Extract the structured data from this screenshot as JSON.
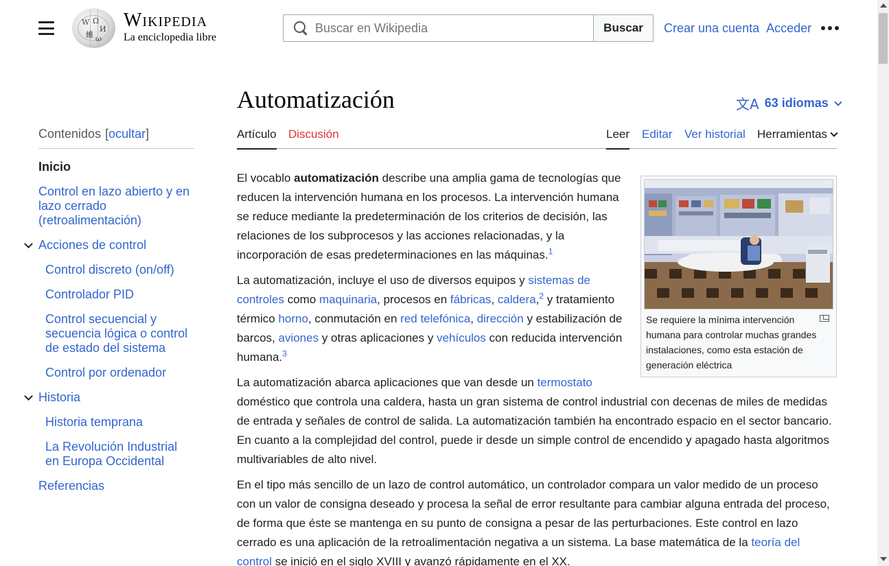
{
  "header": {
    "wordmark": "Wikipedia",
    "tagline": "La enciclopedia libre",
    "search_placeholder": "Buscar en Wikipedia",
    "search_button": "Buscar",
    "create_account": "Crear una cuenta",
    "login": "Acceder"
  },
  "toc": {
    "heading": "Contenidos",
    "toggle_open": "[",
    "toggle_label": "ocultar",
    "toggle_close": "]",
    "items": [
      {
        "label": "Inicio"
      },
      {
        "label": "Control en lazo abierto y en lazo cerrado (retroalimentación)"
      },
      {
        "label": "Acciones de control"
      },
      {
        "label": "Control discreto (on/off)"
      },
      {
        "label": "Controlador PID"
      },
      {
        "label": "Control secuencial y secuencia lógica o control de estado del sistema"
      },
      {
        "label": "Control por ordenador"
      },
      {
        "label": "Historia"
      },
      {
        "label": "Historia temprana"
      },
      {
        "label": "La Revolución Industrial en Europa Occidental"
      },
      {
        "label": "Referencias"
      }
    ]
  },
  "article": {
    "title": "Automatización",
    "languages": "63 idiomas",
    "tabs": {
      "article": "Artículo",
      "talk": "Discusión",
      "read": "Leer",
      "edit": "Editar",
      "history": "Ver historial",
      "tools": "Herramientas"
    },
    "figure_caption": "Se requiere la mínima intervención humana para controlar muchas grandes instalaciones, como esta estación de generación eléctrica",
    "p1": {
      "t1": "El vocablo ",
      "b1": "automatización",
      "t2": " describe una amplia gama de tecnologías que reducen la intervención humana en los procesos. La intervención humana se reduce mediante la predeterminación de los criterios de decisión, las relaciones de los subprocesos y las acciones relacionadas, y la incorporación de esas predeterminaciones en las máquinas.",
      "ref1": "1"
    },
    "p2": {
      "t1": "La automatización, incluye el uso de diversos equipos y ",
      "l1": "sistemas de controles",
      "t2": " como ",
      "l2": "maquinaria",
      "t3": ", procesos en ",
      "l3": "fábricas",
      "t4": ", ",
      "l4": "caldera",
      "t5": ",",
      "ref2": "2",
      "t6": "  y tratamiento térmico ",
      "l5": "horno",
      "t7": ", conmutación en ",
      "l6": "red telefónica",
      "t8": ", ",
      "l7": "dirección",
      "t9": " y estabilización de barcos, ",
      "l8": "aviones",
      "t10": " y otras aplicaciones y ",
      "l9": "vehículos",
      "t11": " con reducida intervención humana.",
      "ref3": "3"
    },
    "p3": {
      "t1": "La automatización abarca aplicaciones que van desde un ",
      "l1": "termostato",
      "t2": " doméstico que controla una caldera, hasta un gran sistema de control industrial con decenas de miles de medidas de entrada y señales de control de salida. La automatización también ha encontrado espacio en el sector bancario. En cuanto a la complejidad del control, puede ir desde un simple control de encendido y apagado hasta algoritmos multivariables de alto nivel."
    },
    "p4": {
      "t1": "En el tipo más sencillo de un lazo de control automático, un controlador compara un valor medido de un proceso con un valor de consigna deseado y procesa la señal de error resultante para cambiar alguna entrada del proceso, de forma que éste se mantenga en su punto de consigna a pesar de las perturbaciones. Este control en lazo cerrado es una aplicación de la retroalimentación negativa a un sistema. La base matemática de la ",
      "l1": "teoría del control",
      "t2": " se inició en el siglo XVIII y avanzó rápidamente en el XX."
    }
  }
}
